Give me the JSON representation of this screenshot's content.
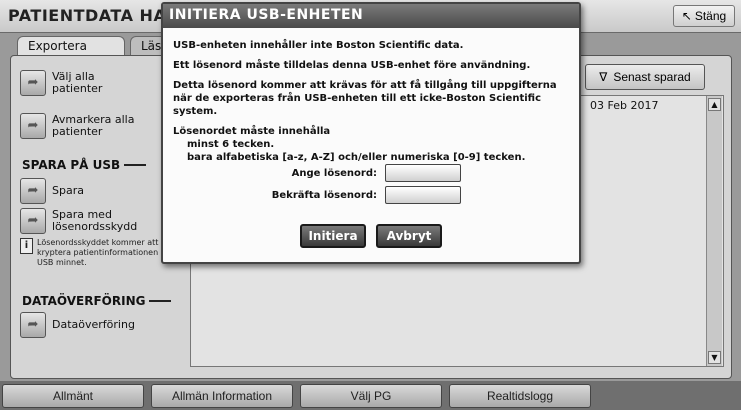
{
  "app": {
    "title": "PATIENTDATA HANT",
    "close_label": "Stäng",
    "close_icon": "arrow-up-left-icon"
  },
  "tabs": [
    {
      "label": "Exportera"
    },
    {
      "label": "Läs"
    }
  ],
  "sidebar": {
    "select_all": "Välj alla patienter",
    "deselect_all": "Avmarkera alla patienter",
    "save_section": "SPARA PÅ USB",
    "save": "Spara",
    "save_protected": "Spara med lösenordsskydd",
    "info_text": "Lösenordsskyddet kommer att kryptera patientinformationen i USB minnet.",
    "transfer_section": "DATAÖVERFÖRING",
    "transfer": "Dataöverföring",
    "item_icon": "arrow-icon"
  },
  "list": {
    "sort_label": "Senast sparad",
    "sort_icon": "funnel-icon",
    "rows": [
      {
        "date": "03 Feb 2017"
      }
    ]
  },
  "dialog": {
    "title": "INITIERA USB-ENHETEN",
    "line1": "USB-enheten innehåller inte Boston Scientific data.",
    "line2": "Ett lösenord måste tilldelas denna USB-enhet före användning.",
    "line3": "Detta lösenord kommer att krävas för att få tillgång till uppgifterna när de exporteras från USB-enheten till ett icke-Boston Scientific system.",
    "req_title": "Lösenordet måste innehålla",
    "req_1": "minst 6 tecken.",
    "req_2": "bara alfabetiska [a-z, A-Z] och/eller numeriska [0-9] tecken.",
    "password_label": "Ange lösenord:",
    "confirm_label": "Bekräfta lösenord:",
    "password_value": "",
    "confirm_value": "",
    "ok_label": "Initiera",
    "cancel_label": "Avbryt"
  },
  "bottom_nav": [
    {
      "label": "Allmänt"
    },
    {
      "label": "Allmän Information"
    },
    {
      "label": "Välj PG"
    },
    {
      "label": "Realtidslogg"
    }
  ]
}
